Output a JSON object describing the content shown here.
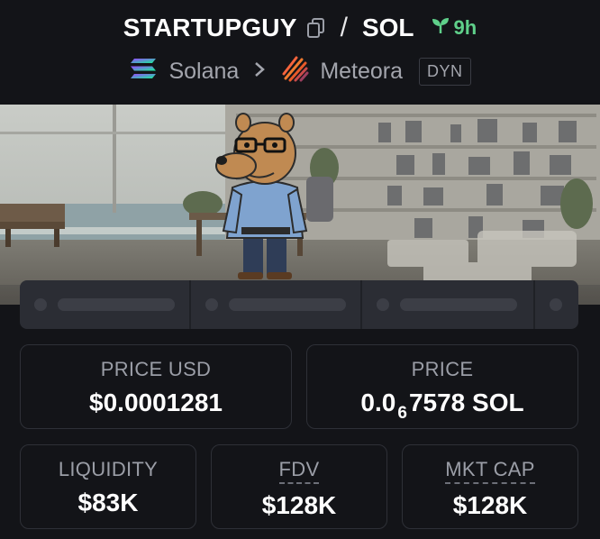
{
  "header": {
    "token_name": "STARTUPGUY",
    "separator": "/",
    "quote_symbol": "SOL",
    "age": "9h",
    "chain": "Solana",
    "dex": "Meteora",
    "pool_type": "DYN"
  },
  "icons": {
    "copy": "copy-icon",
    "age": "seedling-icon",
    "chain": "solana-logo",
    "dex": "meteora-logo",
    "chevron": "chevron-right-icon"
  },
  "stats": {
    "price_usd_label": "PRICE USD",
    "price_usd_value": "$0.0001281",
    "price_label": "PRICE",
    "price_prefix": "0.0",
    "price_zeros": "6",
    "price_digits": "7578",
    "price_unit": "SOL",
    "liquidity_label": "LIQUIDITY",
    "liquidity_value": "$83K",
    "fdv_label": "FDV",
    "fdv_value": "$128K",
    "mktcap_label": "MKT CAP",
    "mktcap_value": "$128K"
  },
  "colors": {
    "background": "#131418",
    "age_green": "#5fd08a",
    "muted_text": "#a3a5ad",
    "card_border": "#2e3037"
  }
}
